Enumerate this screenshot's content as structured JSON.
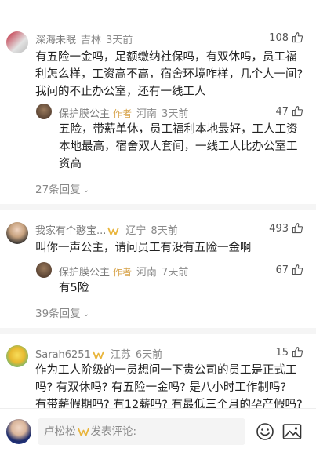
{
  "comments": [
    {
      "username": "深海未眠",
      "location": "吉林",
      "time": "3天前",
      "likes": "108",
      "lines": [
        "有五险一金吗，足额缴纳社保吗，有双休吗，员工福",
        "利怎么样，工资高不高，宿舍环境咋样，几个人一间?",
        "我问的不止办公室，还有一线工人"
      ],
      "reply": {
        "username": "保护膜公主",
        "tag": "作者",
        "location": "河南",
        "time": "3天前",
        "likes": "47",
        "lines": [
          "五险，带薪单休，员工福利本地最好，工人工资",
          "本地最高，宿舍双人套间，一线工人比办公室工",
          "资高"
        ]
      },
      "more": "27条回复"
    },
    {
      "username": "我家有个憨宝...",
      "location": "辽宁",
      "time": "8天前",
      "likes": "493",
      "lines": [
        "叫你一声公主，请问员工有没有五险一金啊"
      ],
      "reply": {
        "username": "保护膜公主",
        "tag": "作者",
        "location": "河南",
        "time": "7天前",
        "likes": "67",
        "lines": [
          "有5险"
        ]
      },
      "more": "39条回复"
    },
    {
      "username": "Sarah6251",
      "location": "江苏",
      "time": "6天前",
      "likes": "15",
      "lines": [
        "作为工人阶级的一员想问一下贵公司的员工是正式工",
        "吗? 有双休吗? 有五险一金吗? 是八小时工作制吗?",
        "有带薪假期吗? 有12薪吗? 有最低三个月的孕产假吗?"
      ]
    }
  ],
  "bottom": {
    "username": "卢松松",
    "placeholder": "发表评论:",
    "emoji_icon": "emoji-icon",
    "image_icon": "image-icon"
  },
  "colors": {
    "vip": "#e9b53c",
    "author": "#d7a34a"
  }
}
